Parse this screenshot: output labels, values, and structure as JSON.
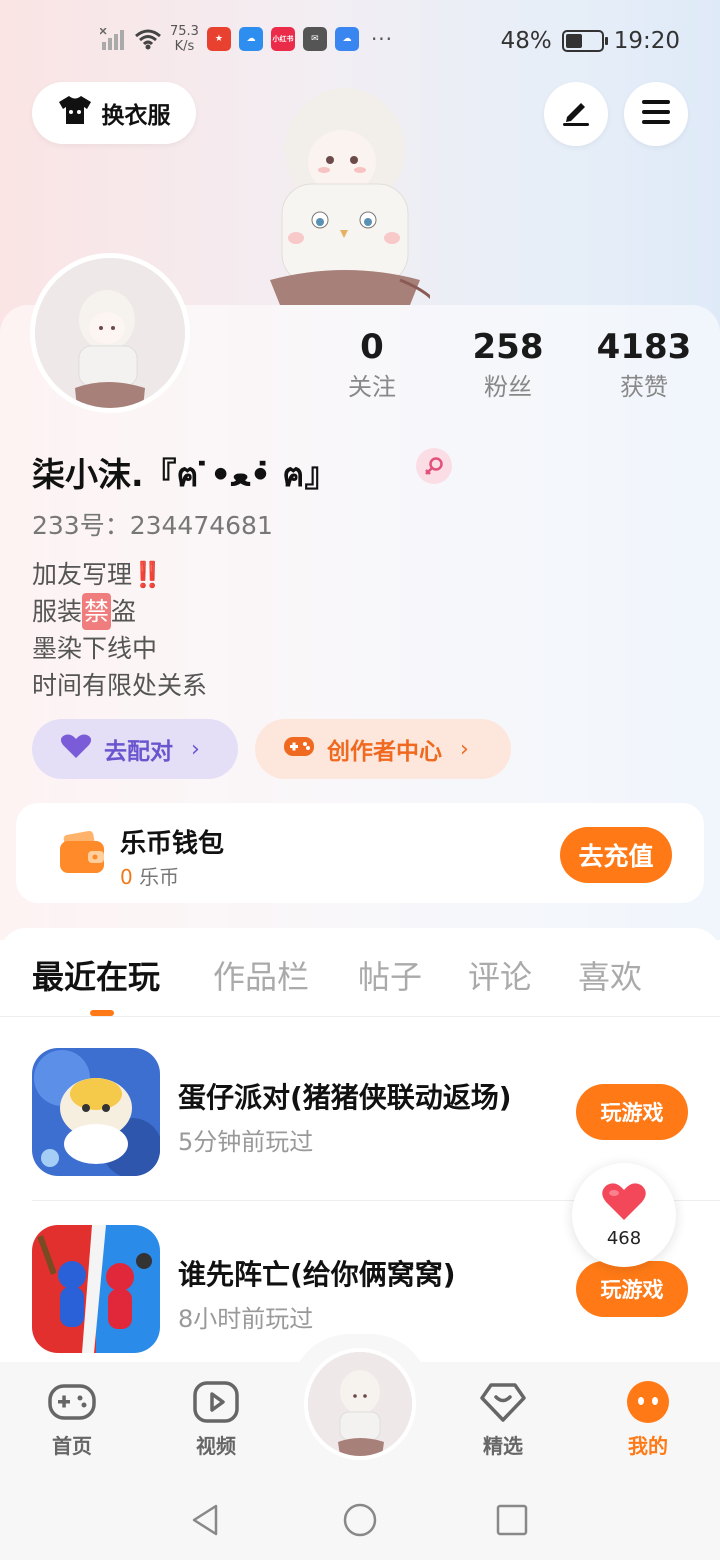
{
  "status_bar": {
    "net_speed_value": "75.3",
    "net_speed_unit": "K/s",
    "more": "···",
    "battery": "48%",
    "time": "19:20",
    "app_icons": [
      {
        "name": "app-icon-red",
        "color": "#e8412f",
        "text": "★"
      },
      {
        "name": "app-icon-weather",
        "color": "#2e8ef0",
        "text": "☁"
      },
      {
        "name": "app-icon-xiaohongshu",
        "color": "#ea2c4a",
        "text": "小红书"
      },
      {
        "name": "app-icon-mail",
        "color": "#555555",
        "text": "✉"
      },
      {
        "name": "app-icon-cloud",
        "color": "#3a86f0",
        "text": "☁"
      }
    ]
  },
  "header": {
    "outfit_label": "换衣服",
    "edit_icon": "pen-icon",
    "menu_icon": "menu-icon"
  },
  "profile": {
    "stats": [
      {
        "value": "0",
        "label": "关注"
      },
      {
        "value": "258",
        "label": "粉丝"
      },
      {
        "value": "4183",
        "label": "获赞"
      }
    ],
    "nickname": "柒小沫.『ฅ ̇•ﻌ• ̇ฅ』",
    "gender_icon": "female-icon",
    "uid": "233号：234474681",
    "bio": [
      "加友写理‼️",
      "服装",
      "禁",
      "盗",
      "墨染下线中",
      "时间有限处关系"
    ]
  },
  "actions": {
    "match_label": "去配对",
    "creator_label": "创作者中心",
    "chevron": "›"
  },
  "wallet": {
    "title": "乐币钱包",
    "balance": "0",
    "unit": "乐币",
    "recharge_label": "去充值"
  },
  "tabs": [
    "最近在玩",
    "作品栏",
    "帖子",
    "评论",
    "喜欢"
  ],
  "games": [
    {
      "name": "蛋仔派对(猪猪侠联动返场)",
      "time": "5分钟前玩过",
      "button": "玩游戏"
    },
    {
      "name": "谁先阵亡(给你俩窝窝)",
      "time": "8小时前玩过",
      "button": "玩游戏"
    }
  ],
  "like_float": {
    "count": "468"
  },
  "bottom_nav": [
    {
      "label": "首页",
      "icon": "gamepad-icon"
    },
    {
      "label": "视频",
      "icon": "video-icon"
    },
    {
      "label": "精选",
      "icon": "heart-diamond-icon"
    },
    {
      "label": "我的",
      "icon": "profile-face-icon"
    }
  ],
  "colors": {
    "accent": "#ff7a16",
    "match_purple": "#6b55cf",
    "creator_orange": "#f06920"
  }
}
